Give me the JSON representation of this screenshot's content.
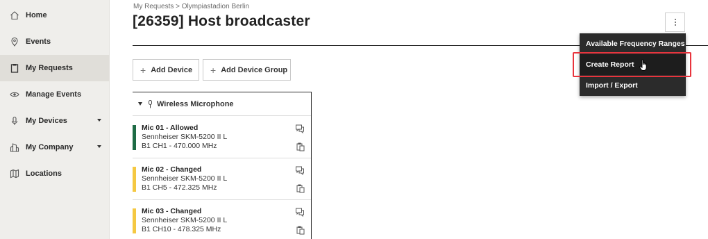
{
  "sidebar": {
    "items": [
      {
        "label": "Home",
        "icon": "home-icon"
      },
      {
        "label": "Events",
        "icon": "map-pin-icon"
      },
      {
        "label": "My Requests",
        "icon": "clipboard-icon"
      },
      {
        "label": "Manage Events",
        "icon": "eye-icon"
      },
      {
        "label": "My Devices",
        "icon": "microphone-icon"
      },
      {
        "label": "My Company",
        "icon": "building-icon"
      },
      {
        "label": "Locations",
        "icon": "map-icon"
      }
    ]
  },
  "breadcrumb": "My Requests > Olympiastadion Berlin",
  "page_title": "[26359] Host broadcaster",
  "toolbar": {
    "add_device": "Add Device",
    "add_device_group": "Add Device Group"
  },
  "device_group": {
    "label": "Wireless Microphone",
    "devices": [
      {
        "name": "Mic 01 - Allowed",
        "model": "Sennheiser SKM-5200 II L",
        "channel": "B1 CH1 - 470.000 MHz",
        "status_color": "#1e6b45"
      },
      {
        "name": "Mic 02 - Changed",
        "model": "Sennheiser SKM-5200 II L",
        "channel": "B1 CH5 - 472.325 MHz",
        "status_color": "#f5c842"
      },
      {
        "name": "Mic 03 - Changed",
        "model": "Sennheiser SKM-5200 II L",
        "channel": "B1 CH10 - 478.325 MHz",
        "status_color": "#f5c842"
      }
    ]
  },
  "menu": {
    "items": [
      "Available Frequency Ranges",
      "Create Report",
      "Import / Export"
    ],
    "highlight_color": "#e8343d"
  }
}
